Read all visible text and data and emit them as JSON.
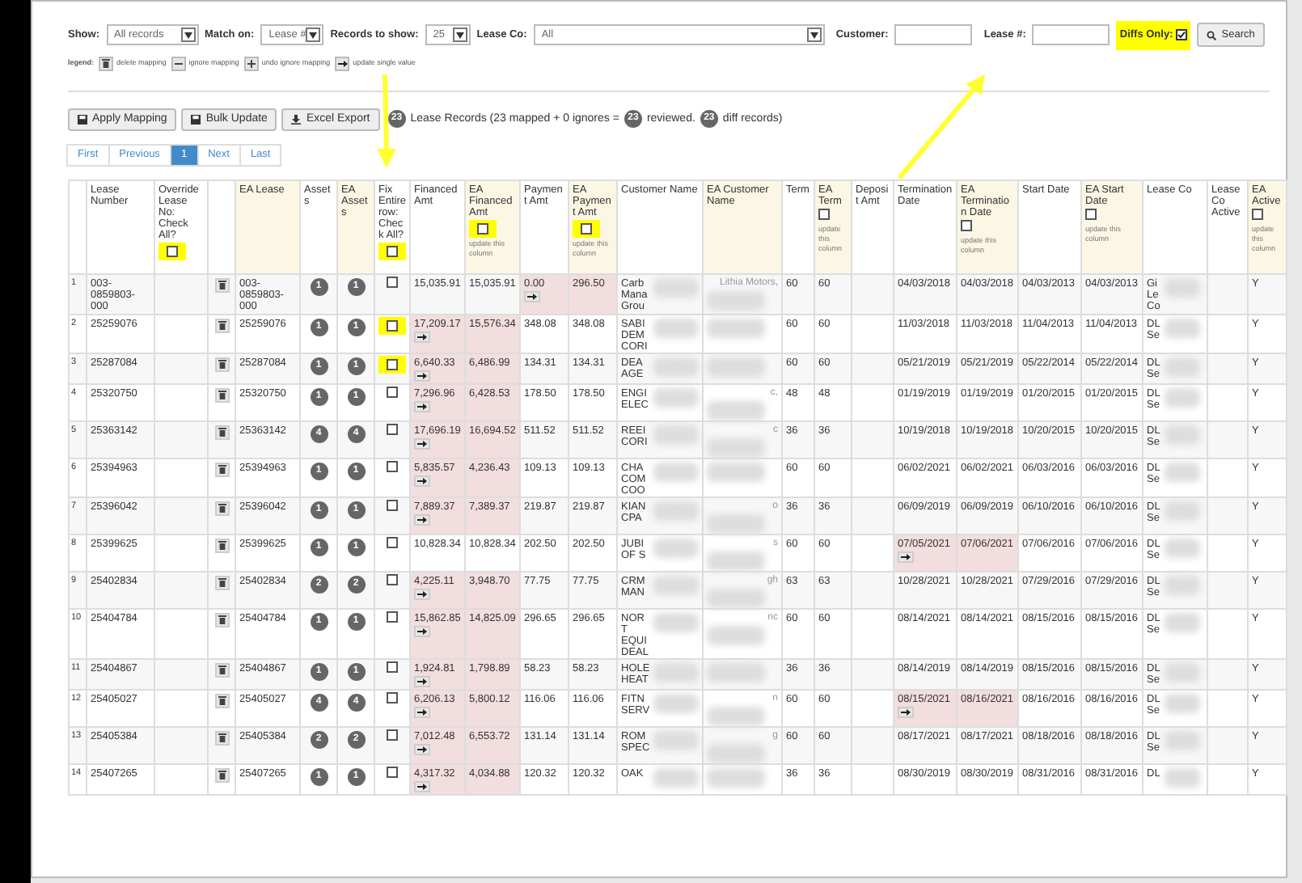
{
  "filters": {
    "show": {
      "label": "Show:",
      "value": "All records"
    },
    "match_on": {
      "label": "Match on:",
      "value": "Lease #"
    },
    "records_to_show": {
      "label": "Records to show:",
      "value": "25"
    },
    "lease_co": {
      "label": "Lease Co:",
      "value": "All"
    },
    "customer": {
      "label": "Customer:"
    },
    "lease_no": {
      "label": "Lease #:"
    },
    "diffs_only": {
      "label": "Diffs Only:",
      "checked": true,
      "highlighted": true
    },
    "search_button": "Search"
  },
  "legend": {
    "label": "legend:",
    "items": [
      {
        "kind": "trash",
        "text": "delete mapping"
      },
      {
        "kind": "minus",
        "text": "ignore mapping"
      },
      {
        "kind": "plus",
        "text": "undo ignore mapping"
      },
      {
        "kind": "arrow",
        "text": "update single value"
      }
    ]
  },
  "actions": [
    {
      "kind": "save",
      "label": "Apply Mapping"
    },
    {
      "kind": "save",
      "label": "Bulk Update"
    },
    {
      "kind": "download",
      "label": "Excel Export"
    }
  ],
  "summary": [
    {
      "kind": "badge",
      "text": "23"
    },
    {
      "kind": "text",
      "text": "Lease Records (23 mapped + 0 ignores ="
    },
    {
      "kind": "badge",
      "text": "23"
    },
    {
      "kind": "text",
      "text": "reviewed."
    },
    {
      "kind": "badge",
      "text": "23"
    },
    {
      "kind": "text",
      "text": "diff records)"
    }
  ],
  "pagination": [
    {
      "label": "First",
      "selected": false
    },
    {
      "label": "Previous",
      "selected": false
    },
    {
      "label": "1",
      "selected": true
    },
    {
      "label": "Next",
      "selected": false
    },
    {
      "label": "Last",
      "selected": false
    }
  ],
  "table": {
    "columns": [
      {
        "label": "Lease Number",
        "ea": false
      },
      {
        "label": "Override Lease No: Check All?",
        "ea": false,
        "checkbox": {
          "checked": false,
          "highlighted": true
        }
      },
      {
        "label": "EA Lease",
        "ea": true
      },
      {
        "label": "Assets",
        "ea": false
      },
      {
        "label": "EA Assets",
        "ea": true
      },
      {
        "label": "Fix Entire row: Check All?",
        "ea": false,
        "checkbox": {
          "checked": false,
          "highlighted": true
        }
      },
      {
        "label": "Financed Amt",
        "ea": false
      },
      {
        "label": "EA Financed Amt",
        "ea": true,
        "checkbox": {
          "checked": false,
          "highlighted": true
        },
        "note": "update this column"
      },
      {
        "label": "Payment Amt",
        "ea": false
      },
      {
        "label": "EA Payment Amt",
        "ea": true,
        "checkbox": {
          "checked": false,
          "highlighted": true
        },
        "note": "update this column"
      },
      {
        "label": "Customer Name",
        "ea": false
      },
      {
        "label": "EA Customer Name",
        "ea": true
      },
      {
        "label": "Term",
        "ea": false
      },
      {
        "label": "EA Term",
        "ea": true,
        "checkbox": {
          "checked": false,
          "highlighted": false
        },
        "note": "update this column"
      },
      {
        "label": "Deposit Amt",
        "ea": false
      },
      {
        "label": "Termination Date",
        "ea": false
      },
      {
        "label": "EA Termination Date",
        "ea": true,
        "checkbox": {
          "checked": false,
          "highlighted": false
        },
        "note": "update this column"
      },
      {
        "label": "Start Date",
        "ea": false
      },
      {
        "label": "EA Start Date",
        "ea": true,
        "checkbox": {
          "checked": false,
          "highlighted": false
        },
        "note": "update this column"
      },
      {
        "label": "Lease Co",
        "ea": false
      },
      {
        "label": "Lease Co Active",
        "ea": false
      },
      {
        "label": "EA Active",
        "ea": true,
        "checkbox": {
          "checked": false,
          "highlighted": false
        },
        "note": "update this column"
      }
    ],
    "rows": [
      {
        "index": "1",
        "lease": "003-0859803-000",
        "ea_lease": "003-0859803-000",
        "assets": "1",
        "ea_assets": "1",
        "fix": {
          "checked": false,
          "highlighted": false
        },
        "financed": "15,035.91",
        "ea_financed": "15,035.91",
        "payment": "0.00",
        "ea_payment": "296.50",
        "customer": "Carb Mana Grou",
        "ea_customer": "Lithia Motors,",
        "term": "60",
        "ea_term": "60",
        "termination": "04/03/2018",
        "ea_termination": "04/03/2018",
        "start": "04/03/2013",
        "ea_start": "04/03/2013",
        "lease_co": "Gi Le Co",
        "ea_active": "Y",
        "financed_diff": false,
        "payment_diff": true,
        "termination_diff": false
      },
      {
        "index": "2",
        "lease": "25259076",
        "ea_lease": "25259076",
        "assets": "1",
        "ea_assets": "1",
        "fix": {
          "checked": false,
          "highlighted": true
        },
        "financed": "17,209.17",
        "ea_financed": "15,576.34",
        "payment": "348.08",
        "ea_payment": "348.08",
        "customer": "SABI DEM CORI",
        "term": "60",
        "ea_term": "60",
        "termination": "11/03/2018",
        "ea_termination": "11/03/2018",
        "start": "11/04/2013",
        "ea_start": "11/04/2013",
        "lease_co": "DL Se",
        "ea_active": "Y",
        "financed_diff": true,
        "payment_diff": false,
        "termination_diff": false
      },
      {
        "index": "3",
        "lease": "25287084",
        "ea_lease": "25287084",
        "assets": "1",
        "ea_assets": "1",
        "fix": {
          "checked": false,
          "highlighted": true
        },
        "financed": "6,640.33",
        "ea_financed": "6,486.99",
        "payment": "134.31",
        "ea_payment": "134.31",
        "customer": "DEA AGE",
        "term": "60",
        "ea_term": "60",
        "termination": "05/21/2019",
        "ea_termination": "05/21/2019",
        "start": "05/22/2014",
        "ea_start": "05/22/2014",
        "lease_co": "DL Se",
        "ea_active": "Y",
        "financed_diff": true,
        "payment_diff": false,
        "termination_diff": false
      },
      {
        "index": "4",
        "lease": "25320750",
        "ea_lease": "25320750",
        "assets": "1",
        "ea_assets": "1",
        "fix": {
          "checked": false,
          "highlighted": false
        },
        "financed": "7,296.96",
        "ea_financed": "6,428.53",
        "payment": "178.50",
        "ea_payment": "178.50",
        "customer": "ENGI ELEC",
        "ea_customer": "c,",
        "term": "48",
        "ea_term": "48",
        "termination": "01/19/2019",
        "ea_termination": "01/19/2019",
        "start": "01/20/2015",
        "ea_start": "01/20/2015",
        "lease_co": "DL Se",
        "ea_active": "Y",
        "financed_diff": true,
        "payment_diff": false,
        "termination_diff": false
      },
      {
        "index": "5",
        "lease": "25363142",
        "ea_lease": "25363142",
        "assets": "4",
        "ea_assets": "4",
        "fix": {
          "checked": false,
          "highlighted": false
        },
        "financed": "17,696.19",
        "ea_financed": "16,694.52",
        "payment": "511.52",
        "ea_payment": "511.52",
        "customer": "REEI CORI",
        "ea_customer": "c",
        "term": "36",
        "ea_term": "36",
        "termination": "10/19/2018",
        "ea_termination": "10/19/2018",
        "start": "10/20/2015",
        "ea_start": "10/20/2015",
        "lease_co": "DL Se",
        "ea_active": "Y",
        "financed_diff": true,
        "payment_diff": false,
        "termination_diff": false
      },
      {
        "index": "6",
        "lease": "25394963",
        "ea_lease": "25394963",
        "assets": "1",
        "ea_assets": "1",
        "fix": {
          "checked": false,
          "highlighted": false
        },
        "financed": "5,835.57",
        "ea_financed": "4,236.43",
        "payment": "109.13",
        "ea_payment": "109.13",
        "customer": "CHA COM COO",
        "term": "60",
        "ea_term": "60",
        "termination": "06/02/2021",
        "ea_termination": "06/02/2021",
        "start": "06/03/2016",
        "ea_start": "06/03/2016",
        "lease_co": "DL Se",
        "ea_active": "Y",
        "financed_diff": true,
        "payment_diff": false,
        "termination_diff": false
      },
      {
        "index": "7",
        "lease": "25396042",
        "ea_lease": "25396042",
        "assets": "1",
        "ea_assets": "1",
        "fix": {
          "checked": false,
          "highlighted": false
        },
        "financed": "7,889.37",
        "ea_financed": "7,389.37",
        "payment": "219.87",
        "ea_payment": "219.87",
        "customer": "KIAN CPA",
        "ea_customer": "o",
        "term": "36",
        "ea_term": "36",
        "termination": "06/09/2019",
        "ea_termination": "06/09/2019",
        "start": "06/10/2016",
        "ea_start": "06/10/2016",
        "lease_co": "DL Se",
        "ea_active": "Y",
        "financed_diff": true,
        "payment_diff": false,
        "termination_diff": false
      },
      {
        "index": "8",
        "lease": "25399625",
        "ea_lease": "25399625",
        "assets": "1",
        "ea_assets": "1",
        "fix": {
          "checked": false,
          "highlighted": false
        },
        "financed": "10,828.34",
        "ea_financed": "10,828.34",
        "payment": "202.50",
        "ea_payment": "202.50",
        "customer": "JUBI OF S",
        "ea_customer": "s",
        "term": "60",
        "ea_term": "60",
        "termination": "07/05/2021",
        "ea_termination": "07/06/2021",
        "start": "07/06/2016",
        "ea_start": "07/06/2016",
        "lease_co": "DL Se",
        "ea_active": "Y",
        "financed_diff": false,
        "payment_diff": false,
        "termination_diff": true
      },
      {
        "index": "9",
        "lease": "25402834",
        "ea_lease": "25402834",
        "assets": "2",
        "ea_assets": "2",
        "fix": {
          "checked": false,
          "highlighted": false
        },
        "financed": "4,225.11",
        "ea_financed": "3,948.70",
        "payment": "77.75",
        "ea_payment": "77.75",
        "customer": "CRM MAN",
        "ea_customer": "gh",
        "term": "63",
        "ea_term": "63",
        "termination": "10/28/2021",
        "ea_termination": "10/28/2021",
        "start": "07/29/2016",
        "ea_start": "07/29/2016",
        "lease_co": "DL Se",
        "ea_active": "Y",
        "financed_diff": true,
        "payment_diff": false,
        "termination_diff": false
      },
      {
        "index": "10",
        "lease": "25404784",
        "ea_lease": "25404784",
        "assets": "1",
        "ea_assets": "1",
        "fix": {
          "checked": false,
          "highlighted": false
        },
        "financed": "15,862.85",
        "ea_financed": "14,825.09",
        "payment": "296.65",
        "ea_payment": "296.65",
        "customer": "NORT EQUI DEAL",
        "ea_customer": "nc",
        "term": "60",
        "ea_term": "60",
        "termination": "08/14/2021",
        "ea_termination": "08/14/2021",
        "start": "08/15/2016",
        "ea_start": "08/15/2016",
        "lease_co": "DL Se",
        "ea_active": "Y",
        "financed_diff": true,
        "payment_diff": false,
        "termination_diff": false
      },
      {
        "index": "11",
        "lease": "25404867",
        "ea_lease": "25404867",
        "assets": "1",
        "ea_assets": "1",
        "fix": {
          "checked": false,
          "highlighted": false
        },
        "financed": "1,924.81",
        "ea_financed": "1,798.89",
        "payment": "58.23",
        "ea_payment": "58.23",
        "customer": "HOLE HEAT",
        "term": "36",
        "ea_term": "36",
        "termination": "08/14/2019",
        "ea_termination": "08/14/2019",
        "start": "08/15/2016",
        "ea_start": "08/15/2016",
        "lease_co": "DL Se",
        "ea_active": "Y",
        "financed_diff": true,
        "payment_diff": false,
        "termination_diff": false
      },
      {
        "index": "12",
        "lease": "25405027",
        "ea_lease": "25405027",
        "assets": "4",
        "ea_assets": "4",
        "fix": {
          "checked": false,
          "highlighted": false
        },
        "financed": "6,206.13",
        "ea_financed": "5,800.12",
        "payment": "116.06",
        "ea_payment": "116.06",
        "customer": "FITN SERV",
        "ea_customer": "n",
        "term": "60",
        "ea_term": "60",
        "termination": "08/15/2021",
        "ea_termination": "08/16/2021",
        "start": "08/16/2016",
        "ea_start": "08/16/2016",
        "lease_co": "DL Se",
        "ea_active": "Y",
        "financed_diff": true,
        "payment_diff": false,
        "termination_diff": true
      },
      {
        "index": "13",
        "lease": "25405384",
        "ea_lease": "25405384",
        "assets": "2",
        "ea_assets": "2",
        "fix": {
          "checked": false,
          "highlighted": false
        },
        "financed": "7,012.48",
        "ea_financed": "6,553.72",
        "payment": "131.14",
        "ea_payment": "131.14",
        "customer": "ROM SPEC",
        "ea_customer": "g",
        "term": "60",
        "ea_term": "60",
        "termination": "08/17/2021",
        "ea_termination": "08/17/2021",
        "start": "08/18/2016",
        "ea_start": "08/18/2016",
        "lease_co": "DL Se",
        "ea_active": "Y",
        "financed_diff": true,
        "payment_diff": false,
        "termination_diff": false
      },
      {
        "index": "14",
        "lease": "25407265",
        "ea_lease": "25407265",
        "assets": "1",
        "ea_assets": "1",
        "fix": {
          "checked": false,
          "highlighted": false
        },
        "financed": "4,317.32",
        "ea_financed": "4,034.88",
        "payment": "120.32",
        "ea_payment": "120.32",
        "customer": "OAK",
        "term": "36",
        "ea_term": "36",
        "termination": "08/30/2019",
        "ea_termination": "08/30/2019",
        "start": "08/31/2016",
        "ea_start": "08/31/2016",
        "lease_co": "DL",
        "ea_active": "Y",
        "financed_diff": true,
        "payment_diff": false,
        "termination_diff": false
      }
    ]
  }
}
